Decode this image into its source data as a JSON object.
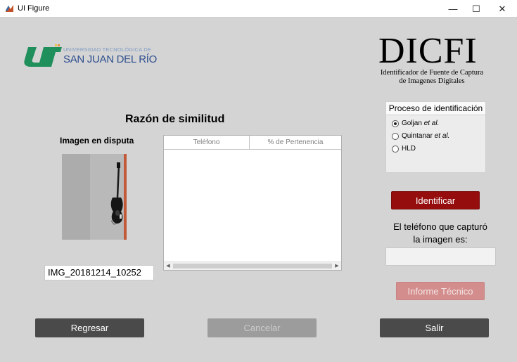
{
  "window": {
    "title": "UI Figure",
    "minimize": "—",
    "maximize": "☐",
    "close": "✕"
  },
  "logo": {
    "line1": "UNIVERSIDAD TECNOLÓGICA DE",
    "line2": "SAN JUAN DEL RÍO",
    "brand_green": "#1f8f5b"
  },
  "brand": {
    "title": "DICFI",
    "subtitle_line1": "Identificador de Fuente de Captura",
    "subtitle_line2": "de Imagenes Digitales"
  },
  "headings": {
    "similarity": "Razón de similitud",
    "disputed_image": "Imagen en disputa"
  },
  "table": {
    "columns": [
      "Teléfono",
      "% de Pertenencia"
    ],
    "rows": []
  },
  "file": {
    "name": "IMG_20181214_10252"
  },
  "process": {
    "title": "Proceso de identificación",
    "options": [
      {
        "name": "Goljan",
        "suffix": "et al.",
        "checked": true
      },
      {
        "name": "Quintanar",
        "suffix": "et al.",
        "checked": false
      },
      {
        "name": "HLD",
        "suffix": "",
        "checked": false
      }
    ]
  },
  "actions": {
    "identify": "Identificar",
    "phone_label_line1": "El teléfono que capturó",
    "phone_label_line2": "la imagen es:",
    "phone_value": "",
    "report": "Informe Técnico",
    "back": "Regresar",
    "cancel": "Cancelar",
    "exit": "Salir"
  },
  "colors": {
    "identify_button": "#960d0d",
    "report_button_disabled": "#d48d8d",
    "dark_button": "#4a4a4a",
    "disabled_button": "#9c9c9c"
  }
}
